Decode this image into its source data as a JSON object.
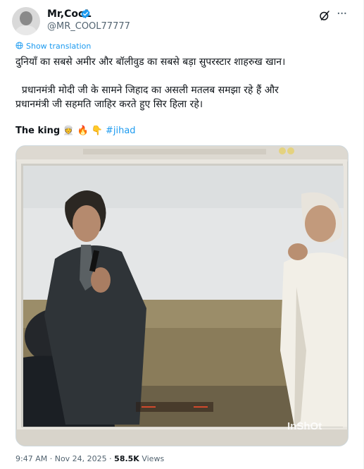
{
  "author": {
    "name": "Mr,CooL",
    "handle": "@MR_COOL77777",
    "verified_color": "#1d9bf0"
  },
  "actions": {
    "grok_icon": "grok-icon",
    "more_icon": "more-icon"
  },
  "translate_label": "Show translation",
  "post": {
    "line1": "दुनियाँ का सबसे अमीर और बॉलीवुड का सबसे बड़ा सुपरस्टार शाहरुख खान।",
    "line2": "  प्रधानमंत्री मोदी जी के सामने जिहाद का असली मतलब समझा रहे हैं और",
    "line3": "प्रधानमंत्री जी सहमति जाहिर करते हुए सिर हिला रहे।",
    "king_text": "The king",
    "emojis": "👳 🔥 👇",
    "hashtag": "#jihad"
  },
  "media": {
    "watermark": "InShOt"
  },
  "meta": {
    "time": "9:47 AM",
    "sep": "·",
    "date": "Nov 24, 2025",
    "views_count": "58.5K",
    "views_label": "Views"
  },
  "colors": {
    "link": "#1d9bf0",
    "secondary_text": "#536471",
    "border": "#cfd9de"
  }
}
